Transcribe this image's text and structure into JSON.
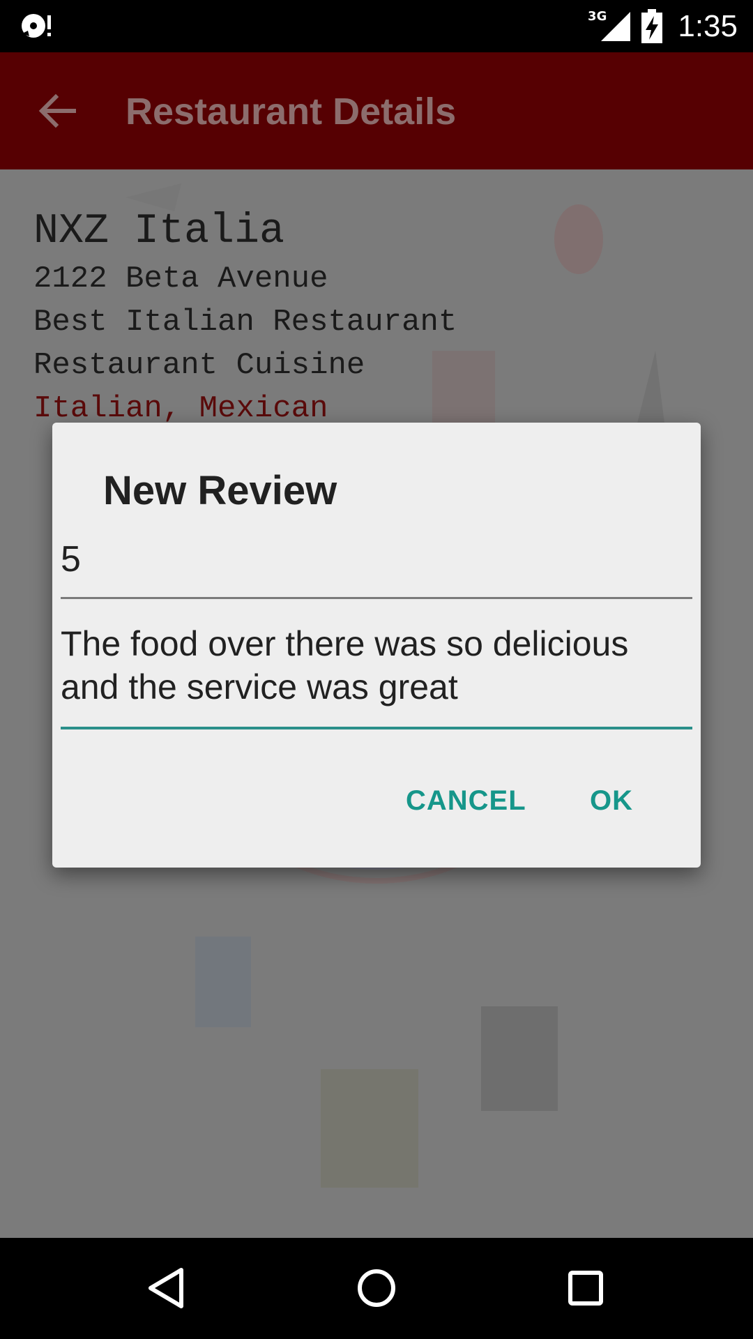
{
  "status_bar": {
    "network": "3G",
    "time": "1:35",
    "icons": [
      "media-notification-icon",
      "signal-icon",
      "battery-charging-icon"
    ]
  },
  "app_bar": {
    "title": "Restaurant Details",
    "back_icon": "arrow-back-icon",
    "color": "#560002"
  },
  "restaurant": {
    "name": "NXZ Italia",
    "address": "2122 Beta Avenue",
    "tagline": "Best Italian Restaurant",
    "cuisine_label": "Restaurant Cuisine",
    "cuisines": "Italian, Mexican"
  },
  "dialog": {
    "title": "New Review",
    "rating_value": "5",
    "review_text": "The food over there was so delicious and the service was great",
    "cancel_label": "CANCEL",
    "ok_label": "OK",
    "accent_color": "#16968a"
  },
  "nav_bar": {
    "icons": [
      "nav-back-icon",
      "nav-home-icon",
      "nav-recents-icon"
    ]
  }
}
